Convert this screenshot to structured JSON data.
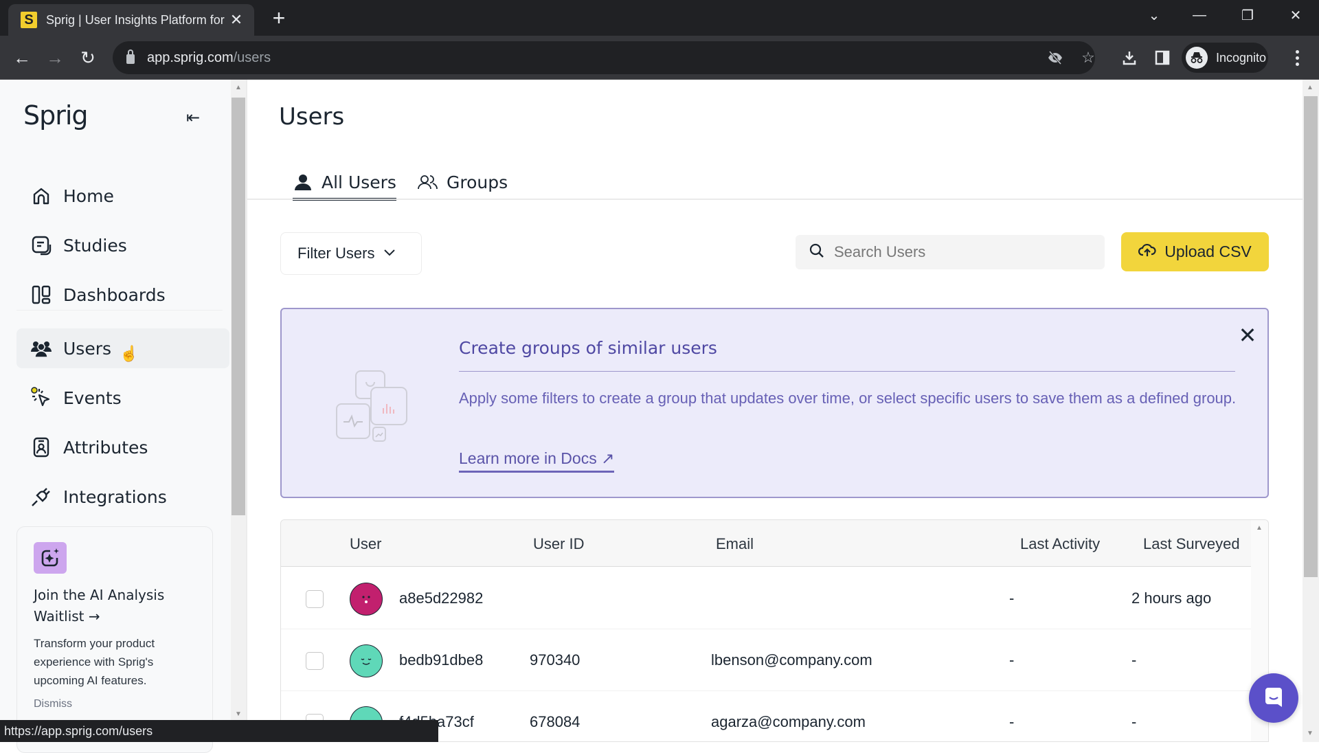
{
  "browser": {
    "tab_title": "Sprig | User Insights Platform for",
    "favicon_letter": "S",
    "url_host": "app.sprig.com",
    "url_path": "/users",
    "profile_label": "Incognito",
    "status_url": "https://app.sprig.com/users"
  },
  "sidebar": {
    "logo": "Sprig",
    "items": [
      {
        "label": "Home",
        "icon": "home-icon"
      },
      {
        "label": "Studies",
        "icon": "studies-icon"
      },
      {
        "label": "Dashboards",
        "icon": "dashboards-icon"
      },
      {
        "label": "Users",
        "icon": "users-icon",
        "active": true
      },
      {
        "label": "Events",
        "icon": "events-icon"
      },
      {
        "label": "Attributes",
        "icon": "attributes-icon"
      },
      {
        "label": "Integrations",
        "icon": "integrations-icon"
      }
    ],
    "promo": {
      "title": "Join the AI Analysis Waitlist →",
      "text": "Transform your product experience with Sprig's upcoming AI features.",
      "dismiss": "Dismiss"
    }
  },
  "main": {
    "title": "Users",
    "tabs": [
      {
        "label": "All Users",
        "icon": "user-icon",
        "active": true
      },
      {
        "label": "Groups",
        "icon": "groups-icon",
        "active": false
      }
    ],
    "filter_label": "Filter Users",
    "search_placeholder": "Search Users",
    "search_value": "",
    "upload_label": "Upload CSV",
    "banner": {
      "title": "Create groups of similar users",
      "text": "Apply some filters to create a group that updates over time, or select specific users to save them as a defined group.",
      "link": "Learn more in Docs ↗"
    },
    "table": {
      "columns": [
        "User",
        "User ID",
        "Email",
        "Last Activity",
        "Last Surveyed"
      ],
      "rows": [
        {
          "user": "a8e5d22982",
          "user_id": "",
          "email": "",
          "last_activity": "-",
          "last_surveyed": "2 hours ago",
          "avatar_color": "#c2206e",
          "checked": false
        },
        {
          "user": "bedb91dbe8",
          "user_id": "970340",
          "email": "lbenson@company.com",
          "last_activity": "-",
          "last_surveyed": "-",
          "avatar_color": "#5fd8b8",
          "checked": false
        },
        {
          "user": "f4d5ba73cf",
          "user_id": "678084",
          "email": "agarza@company.com",
          "last_activity": "-",
          "last_surveyed": "-",
          "avatar_color": "#5fd8b8",
          "checked": false
        }
      ]
    }
  },
  "colors": {
    "accent_yellow": "#f2d53c",
    "banner_bg": "#ecebfa",
    "banner_text": "#4f48a3",
    "chat_button": "#5b50c9"
  }
}
